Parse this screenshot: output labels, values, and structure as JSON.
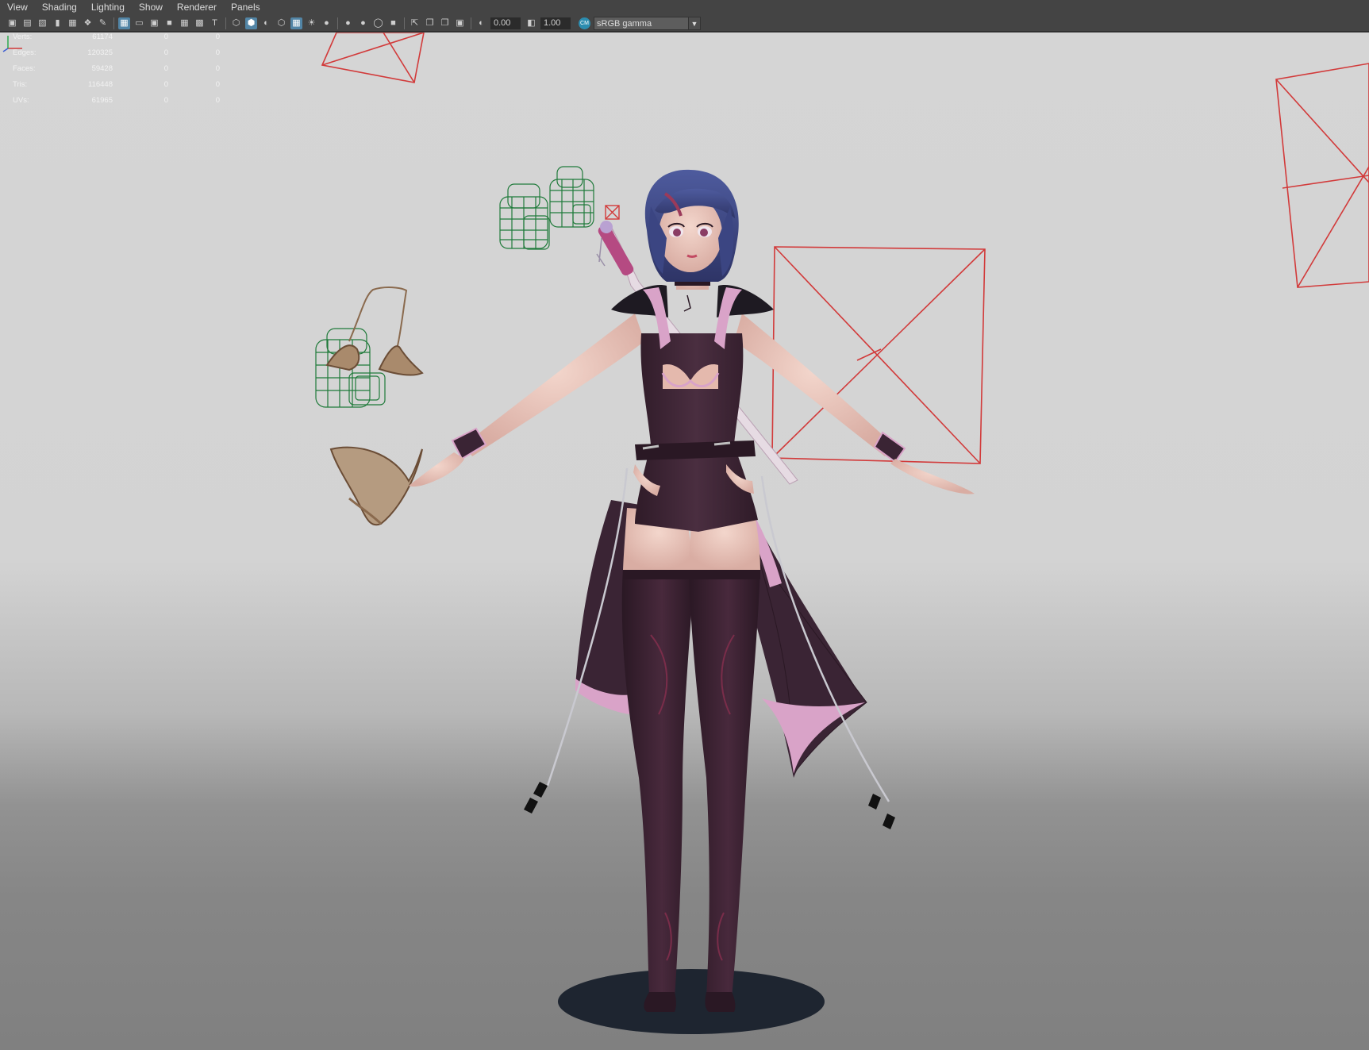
{
  "menu": [
    "View",
    "Shading",
    "Lighting",
    "Show",
    "Renderer",
    "Panels"
  ],
  "toolbar": {
    "exposure": "0.00",
    "gamma": "1.00",
    "color_management": "sRGB gamma"
  },
  "hud": [
    {
      "label": "Verts:",
      "values": [
        "61174",
        "0",
        "0"
      ]
    },
    {
      "label": "Edges:",
      "values": [
        "120325",
        "0",
        "0"
      ]
    },
    {
      "label": "Faces:",
      "values": [
        "59428",
        "0",
        "0"
      ]
    },
    {
      "label": "Tris:",
      "values": [
        "116448",
        "0",
        "0"
      ]
    },
    {
      "label": "UVs:",
      "values": [
        "61965",
        "0",
        "0"
      ]
    }
  ],
  "colors": {
    "wireframe_red": "#d23a3a",
    "wireframe_green": "#1f7a3a",
    "suit": "#3f2636",
    "cape_lining": "#d9a3c8",
    "skin": "#e9c7bd",
    "hair": "#3f4a8c"
  }
}
